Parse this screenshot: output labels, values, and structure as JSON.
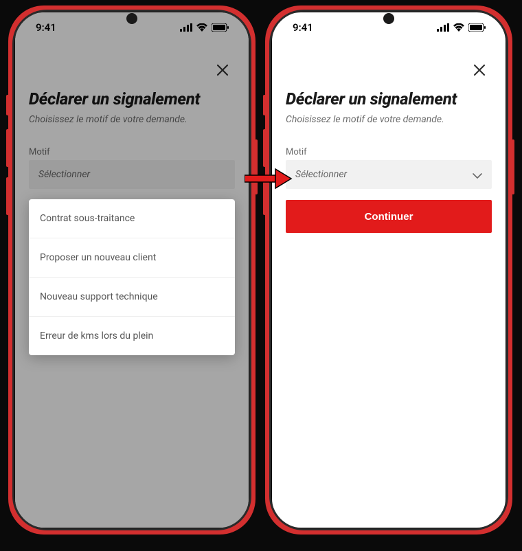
{
  "status": {
    "time": "9:41"
  },
  "sheet": {
    "title": "Déclarer un signalement",
    "subtitle": "Choisissez le motif de votre demande.",
    "field_label": "Motif",
    "select_placeholder": "Sélectionner",
    "continue_label": "Continuer"
  },
  "dropdown": {
    "items": [
      {
        "label": "Contrat sous-traitance"
      },
      {
        "label": "Proposer un nouveau client"
      },
      {
        "label": "Nouveau support technique"
      },
      {
        "label": "Erreur de kms lors du plein"
      }
    ]
  }
}
